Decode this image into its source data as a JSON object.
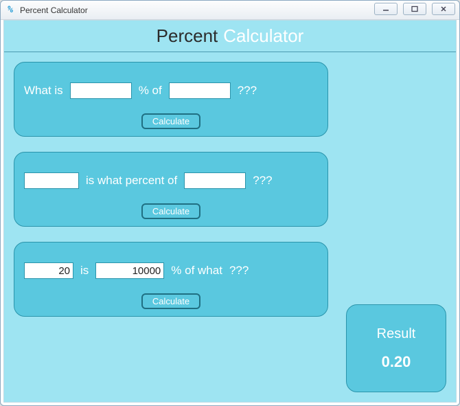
{
  "window": {
    "title": "Percent Calculator"
  },
  "header": {
    "word1": "Percent",
    "word2": "Calculator"
  },
  "card1": {
    "label_whatis": "What is",
    "input_percent": "",
    "label_pctof": "% of",
    "input_of": "",
    "label_qmarks": "???",
    "calculate": "Calculate"
  },
  "card2": {
    "input_a": "",
    "label_iswhatpct": "is what percent of",
    "input_b": "",
    "label_qmarks": "???",
    "calculate": "Calculate"
  },
  "card3": {
    "input_a": "20",
    "label_is": "is",
    "input_b": "10000",
    "label_pctofwhat": "% of what",
    "label_qmarks": "???",
    "calculate": "Calculate"
  },
  "result": {
    "label": "Result",
    "value": "0.20"
  }
}
